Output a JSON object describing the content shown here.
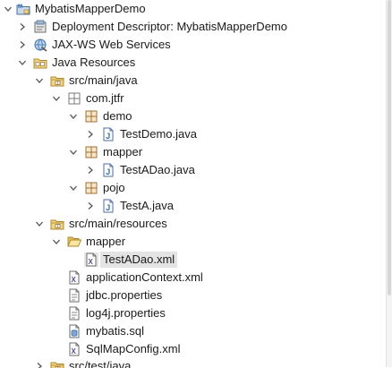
{
  "tree": {
    "project": "MybatisMapperDemo",
    "deployment_descriptor": "Deployment Descriptor: MybatisMapperDemo",
    "jaxws": "JAX-WS Web Services",
    "java_resources": "Java Resources",
    "src_main_java": "src/main/java",
    "pkg_com_jtfr": "com.jtfr",
    "pkg_demo": "demo",
    "file_testdemo": "TestDemo.java",
    "pkg_mapper": "mapper",
    "file_testadao_java": "TestADao.java",
    "pkg_pojo": "pojo",
    "file_testa_java": "TestA.java",
    "src_main_resources": "src/main/resources",
    "folder_mapper": "mapper",
    "file_testadao_xml": "TestADao.xml",
    "file_appcontext": "applicationContext.xml",
    "file_jdbc": "jdbc.properties",
    "file_log4j": "log4j.properties",
    "file_mybatis_sql": "mybatis.sql",
    "file_sqlmapconfig": "SqlMapConfig.xml",
    "src_test_java": "src/test/java"
  },
  "icons": {
    "project": "web-project-icon",
    "deployment_descriptor": "deployment-descriptor-icon",
    "jaxws": "web-services-icon",
    "java_resources": "java-resources-icon",
    "source_folder": "source-folder-icon",
    "package": "package-icon",
    "java_file": "java-file-icon",
    "folder_open": "open-folder-icon",
    "xml_file": "xml-file-icon",
    "properties_file": "properties-file-icon",
    "sql_file": "sql-file-icon"
  },
  "colors": {
    "selection": "#e4e4e4",
    "package_brown": "#a0703a",
    "java_blue": "#2f6db4",
    "folder_yellow": "#e9c35a"
  }
}
